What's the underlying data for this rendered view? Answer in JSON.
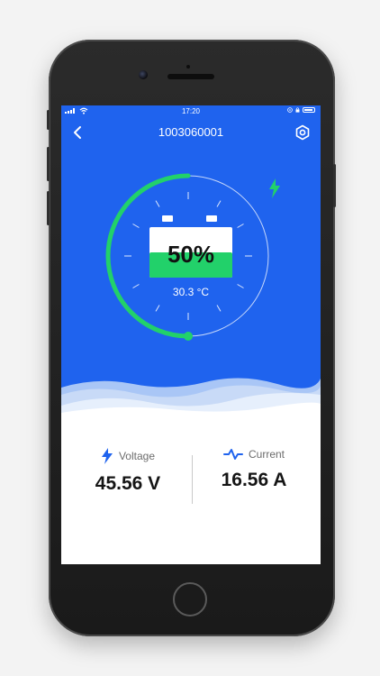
{
  "status_bar": {
    "time": "17:20"
  },
  "header": {
    "device_id": "1003060001"
  },
  "battery": {
    "percent_label": "50%",
    "percent_value": 50,
    "temperature": "30.3 °C",
    "state": "charging"
  },
  "metrics": {
    "voltage": {
      "label": "Voltage",
      "value": "45.56 V"
    },
    "current": {
      "label": "Current",
      "value": "16.56 A"
    }
  },
  "icons": {
    "back": "back-chevron-icon",
    "settings": "gear-icon",
    "charging": "lightning-icon",
    "voltage": "lightning-icon",
    "current": "pulse-wave-icon"
  },
  "colors": {
    "primary_blue": "#1f63ee",
    "accent_green": "#22d16a",
    "wave_light": "#c8daf7",
    "text_dark": "#151515"
  }
}
